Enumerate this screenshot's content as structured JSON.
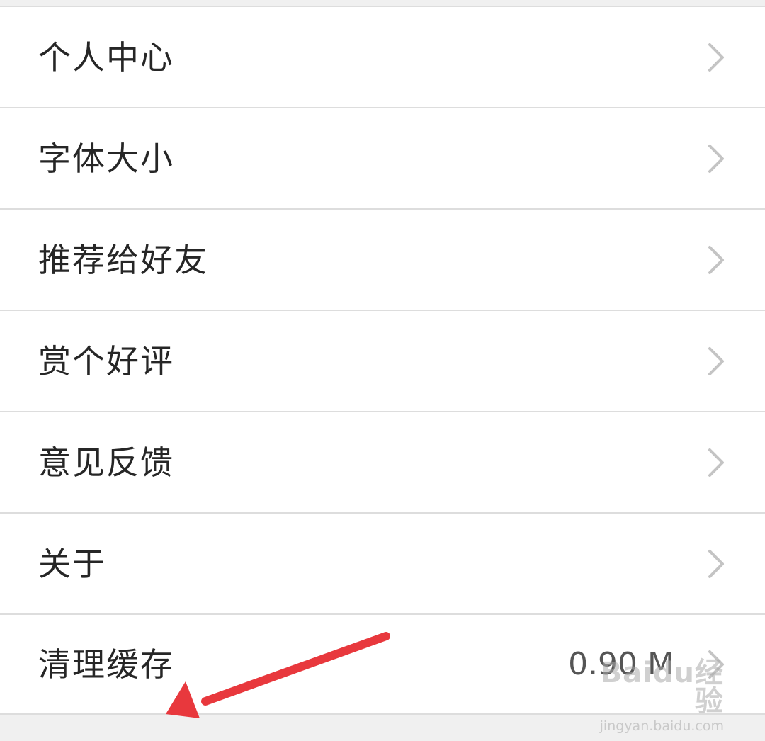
{
  "settings": {
    "items": [
      {
        "label": "个人中心",
        "value": ""
      },
      {
        "label": "字体大小",
        "value": ""
      },
      {
        "label": "推荐给好友",
        "value": ""
      },
      {
        "label": "赏个好评",
        "value": ""
      },
      {
        "label": "意见反馈",
        "value": ""
      },
      {
        "label": "关于",
        "value": ""
      },
      {
        "label": "清理缓存",
        "value": "0.90 M"
      }
    ]
  },
  "icons": {
    "row_chevron": "chevron-right-icon",
    "annotation": "red-arrow-icon"
  },
  "colors": {
    "row_background": "#ffffff",
    "divider": "#dddddd",
    "label_text": "#262626",
    "chevron": "#c4c4c4",
    "annotation_arrow": "#e8383d"
  },
  "watermark": {
    "brand": "Baidu经验",
    "url": "jingyan.baidu.com"
  }
}
